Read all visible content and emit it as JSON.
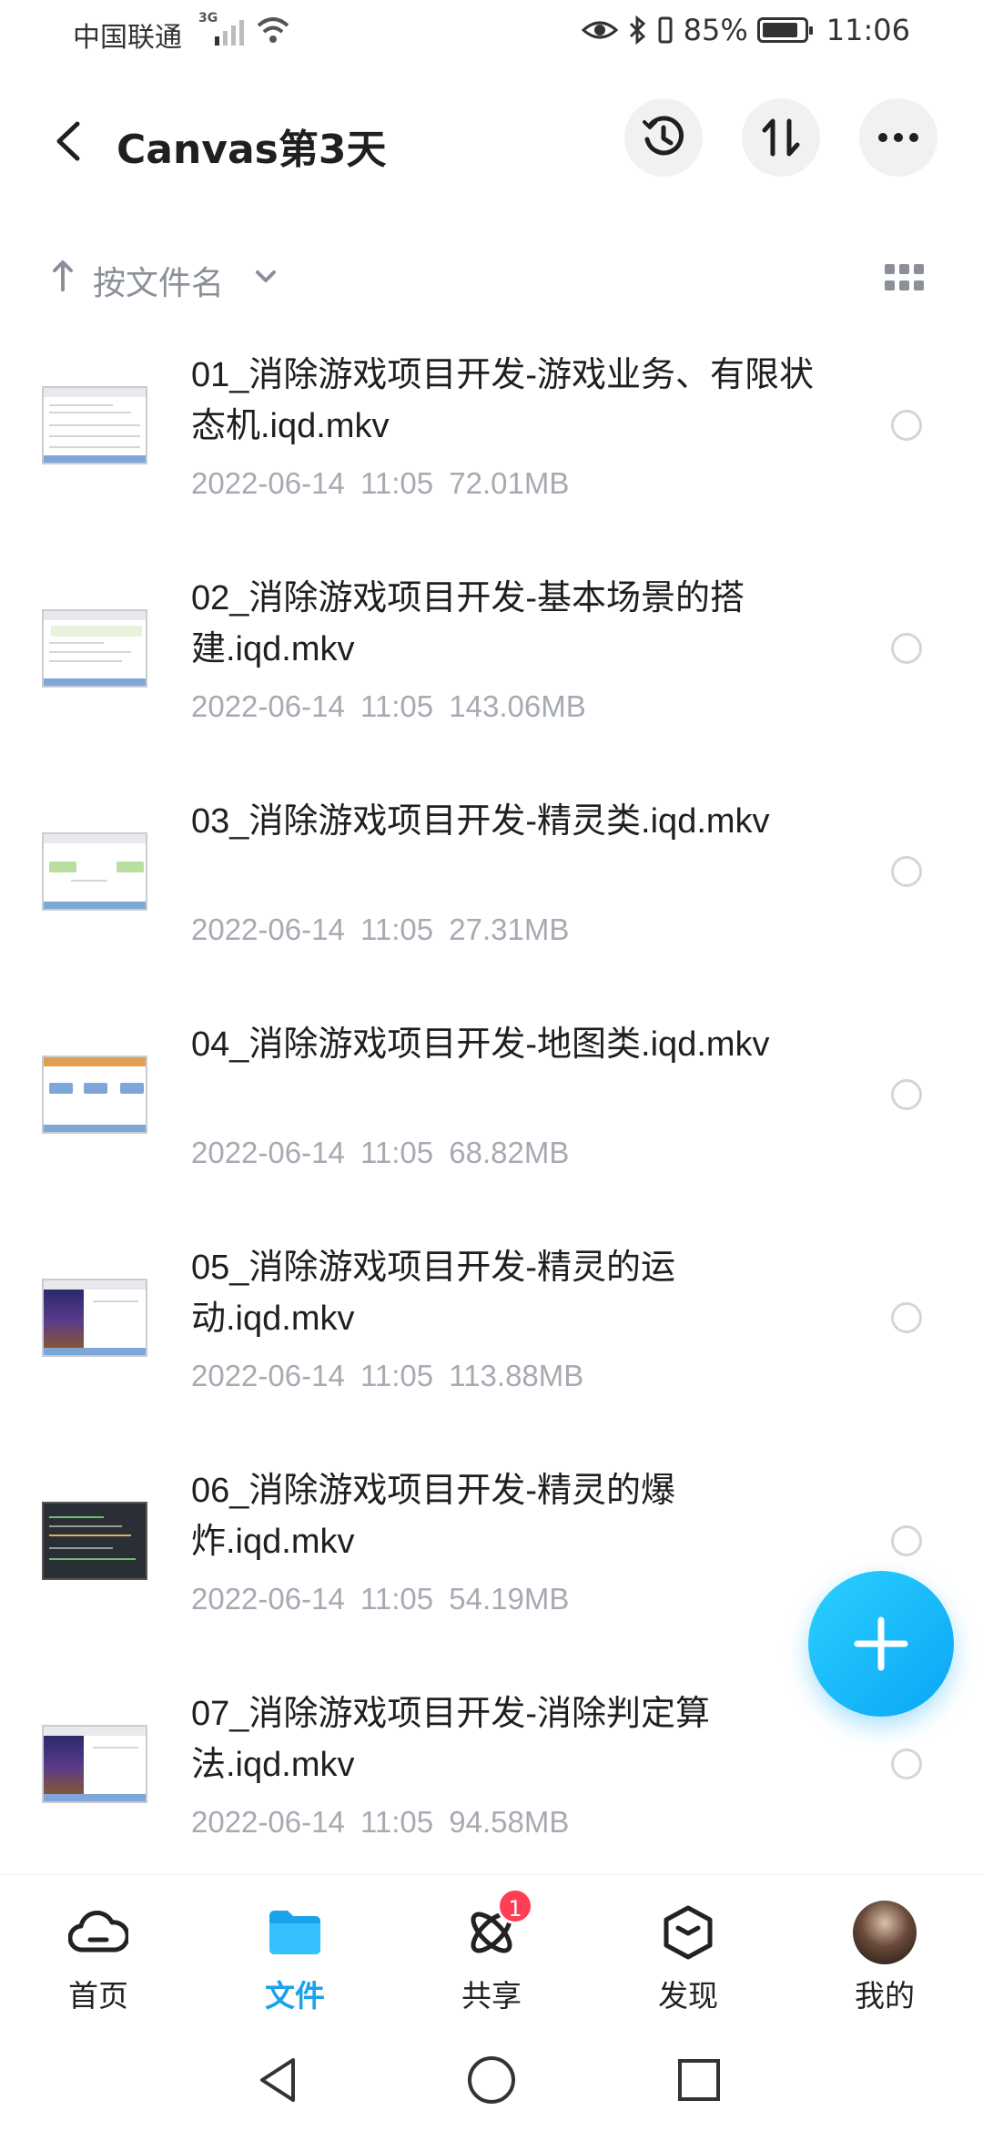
{
  "status_bar": {
    "carrier": "中国联通",
    "network": "3G",
    "battery": "85%",
    "time": "11:06"
  },
  "header": {
    "title": "Canvas第3天",
    "icons": [
      "back-arrow",
      "history-clock",
      "sort-swap",
      "more-dots"
    ]
  },
  "sort": {
    "label": "按文件名"
  },
  "files": [
    {
      "name": "01_消除游戏项目开发-游戏业务、有限状态机.iqd.mkv",
      "date": "2022-06-14",
      "time": "11:05",
      "size": "72.01MB"
    },
    {
      "name": "02_消除游戏项目开发-基本场景的搭建.iqd.mkv",
      "date": "2022-06-14",
      "time": "11:05",
      "size": "143.06MB"
    },
    {
      "name": "03_消除游戏项目开发-精灵类.iqd.mkv",
      "date": "2022-06-14",
      "time": "11:05",
      "size": "27.31MB"
    },
    {
      "name": "04_消除游戏项目开发-地图类.iqd.mkv",
      "date": "2022-06-14",
      "time": "11:05",
      "size": "68.82MB"
    },
    {
      "name": "05_消除游戏项目开发-精灵的运动.iqd.mkv",
      "date": "2022-06-14",
      "time": "11:05",
      "size": "113.88MB"
    },
    {
      "name": "06_消除游戏项目开发-精灵的爆炸.iqd.mkv",
      "date": "2022-06-14",
      "time": "11:05",
      "size": "54.19MB"
    },
    {
      "name": "07_消除游戏项目开发-消除判定算法.iqd.mkv",
      "date": "2022-06-14",
      "time": "11:05",
      "size": "94.58MB"
    }
  ],
  "fab": {
    "icon": "plus"
  },
  "nav": {
    "items": [
      {
        "label": "首页",
        "icon": "cloud-icon"
      },
      {
        "label": "文件",
        "icon": "folder-icon",
        "active": true
      },
      {
        "label": "共享",
        "icon": "atom-icon",
        "badge": "1"
      },
      {
        "label": "发现",
        "icon": "cube-icon"
      },
      {
        "label": "我的",
        "icon": "avatar"
      }
    ]
  },
  "colors": {
    "accent": "#1aa3ec",
    "badge": "#ff3d55",
    "meta_text": "#a6aab2"
  }
}
